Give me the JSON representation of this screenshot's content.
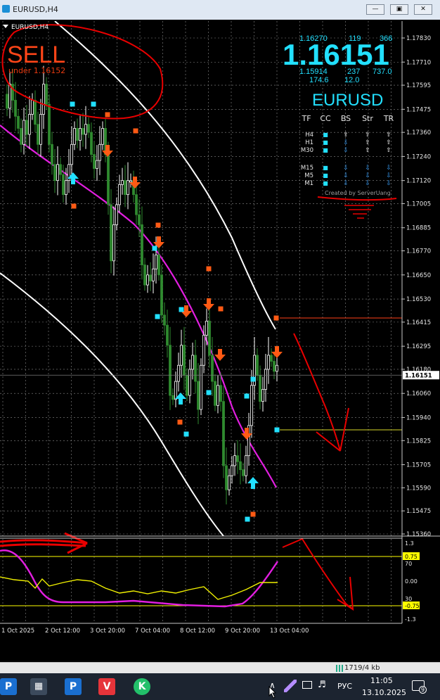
{
  "window": {
    "title": "EURUSD,H4",
    "minimize_glyph": "—",
    "maximize_glyph": "▣",
    "close_glyph": "✕"
  },
  "chart": {
    "symbol_label": "EURUSD,H4",
    "signal": "SELL",
    "signal_sub": "under 1.16152",
    "quote": {
      "price": "1.16151",
      "high": "1.16270",
      "spread_top": "119",
      "range_top": "366",
      "low": "1.15914",
      "spread_bottom": "237",
      "range_bottom": "737.0",
      "stat1": "174.6",
      "stat2": "12.0",
      "symbol": "EURUSD"
    },
    "signal_table": {
      "headers": [
        "TF",
        "CC",
        "BS",
        "Str",
        "TR"
      ],
      "rows": [
        {
          "tf": "H4",
          "cc": "■",
          "bs": "⇧",
          "str": "⇧",
          "tr": "⇧"
        },
        {
          "tf": "H1",
          "cc": "■",
          "bs": "⇩",
          "str": "⇧",
          "tr": "⇧"
        },
        {
          "tf": "M30",
          "cc": "■",
          "bs": "⇩",
          "str": "⇧",
          "tr": "⇧"
        },
        {
          "tf": "M15",
          "cc": "■",
          "bs": "⇩",
          "str": "⇩",
          "tr": "⇩"
        },
        {
          "tf": "M5",
          "cc": "■",
          "bs": "⇩",
          "str": "⇩",
          "tr": "⇩"
        },
        {
          "tf": "M1",
          "cc": "■",
          "bs": "⇩",
          "str": "⇩",
          "tr": "⇩"
        }
      ],
      "credit": "Created by ServerUang"
    },
    "price_axis": [
      "1.17830",
      "1.17710",
      "1.17595",
      "1.17475",
      "1.17360",
      "1.17240",
      "1.17120",
      "1.17005",
      "1.16885",
      "1.16770",
      "1.16650",
      "1.16530",
      "1.16415",
      "1.16295",
      "1.16180",
      "1.16060",
      "1.15940",
      "1.15825",
      "1.15705",
      "1.15590",
      "1.15475",
      "1.15360"
    ],
    "current_price_tag": "1.16151",
    "osc_axis": [
      "1.3",
      "0.75",
      "70",
      "0.00",
      "30",
      "-0.75",
      "-1.3"
    ],
    "time_axis": [
      "1 Oct 2025",
      "2 Oct 12:00",
      "3 Oct 20:00",
      "7 Oct 04:00",
      "8 Oct 12:00",
      "9 Oct 20:00",
      "13 Oct 04:00"
    ],
    "colors": {
      "bull": "#ffffff",
      "bear": "#2f8a2f",
      "ma": "#e21ee0",
      "band": "#ffffff",
      "sell_arrow": "#ff5a14",
      "buy_arrow": "#22e0ff",
      "quote": "#22e0ff",
      "sell_text": "#ff4518",
      "osc1": "#e21ee0",
      "osc2": "#f0f000",
      "draw": "#e80000"
    }
  },
  "status": {
    "text": "1719/4 kb"
  },
  "taskbar": {
    "apps": [
      "terminal-app-icon",
      "calculator-app-icon",
      "terminal2-app-icon",
      "vivaldi-app-icon",
      "kucoin-app-icon"
    ],
    "app_glyphs": [
      "P",
      "▦",
      "P",
      "V",
      "K"
    ],
    "tray_chevron": "∧",
    "language": "РУС",
    "time": "11:05",
    "date": "13.10.2025",
    "notifications": "9"
  }
}
